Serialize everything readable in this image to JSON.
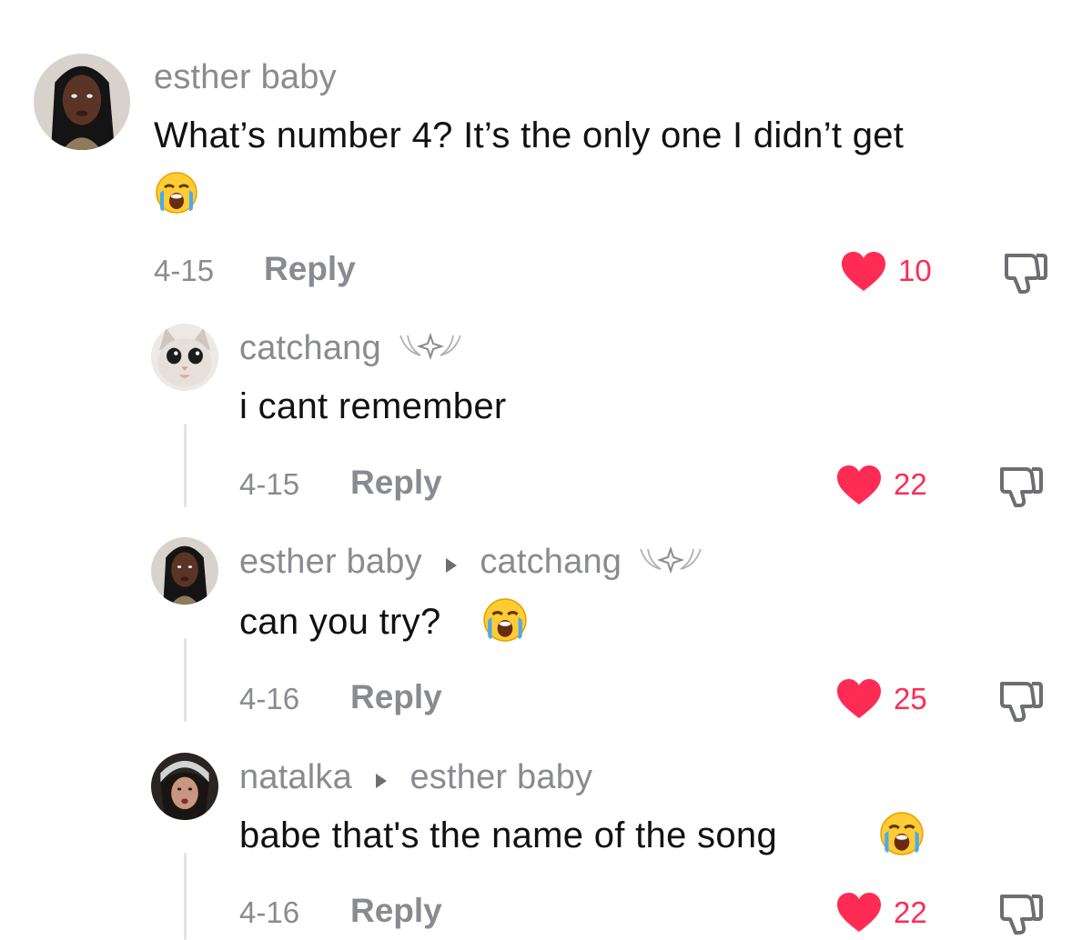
{
  "colors": {
    "like": "#fe2c55",
    "muted": "#8a8b91",
    "text": "#111111"
  },
  "comments": [
    {
      "username": "esther baby",
      "text": "What’s number 4? It’s the only one I didn’t get",
      "date": "4-15",
      "reply_label": "Reply",
      "likes": "10"
    },
    {
      "username": "catchang",
      "text": "i cant remember",
      "date": "4-15",
      "reply_label": "Reply",
      "likes": "22"
    },
    {
      "username": "esther baby",
      "reply_to": "catchang",
      "text": "can you try?",
      "date": "4-16",
      "reply_label": "Reply",
      "likes": "25"
    },
    {
      "username": "natalka",
      "reply_to": "esther baby",
      "text": "babe that's the name of the song",
      "date": "4-16",
      "reply_label": "Reply",
      "likes": "22"
    }
  ],
  "icons": [
    "heart-icon",
    "dislike-icon",
    "crying-emoji-icon",
    "wings-sparkle-badge-icon",
    "reply-to-arrow-icon"
  ]
}
